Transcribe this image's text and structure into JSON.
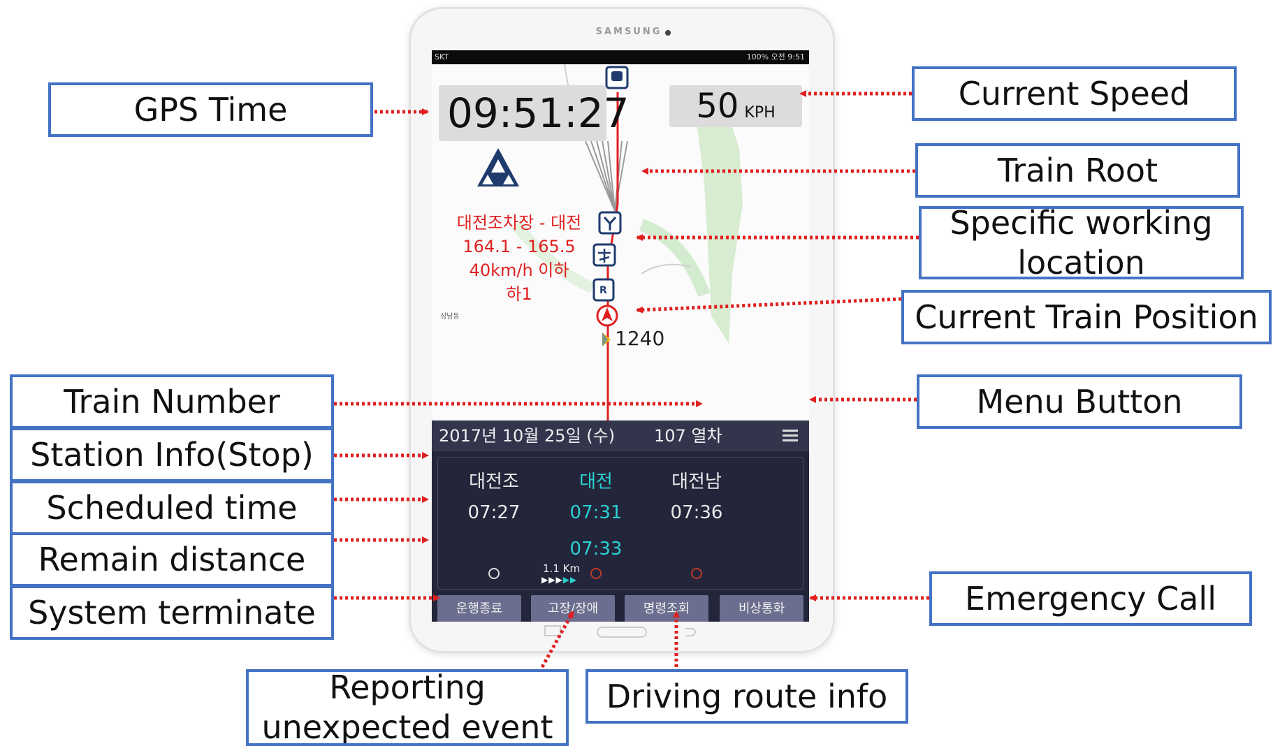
{
  "device": {
    "brand": "SAMSUNG",
    "status_left": "SKT",
    "status_right": "100% 오전 9:51"
  },
  "app": {
    "gps_time": "09:51:27",
    "speed_value": "50",
    "speed_unit": "KPH",
    "warning": {
      "line1": "대전조차장 - 대전",
      "line2": "164.1 - 165.5",
      "line3": "40km/h 이하",
      "line4": "하1"
    },
    "map_place_small": "성남동",
    "km_marker": "1240",
    "date": "2017년 10월 25일 (수)",
    "train_number": "107 열차",
    "stations": [
      {
        "name": "대전조",
        "time": "07:27",
        "time2": ""
      },
      {
        "name": "대전",
        "time": "07:31",
        "time2": "07:33"
      },
      {
        "name": "대전남",
        "time": "07:36",
        "time2": ""
      }
    ],
    "remain_distance": "1.1 Km",
    "buttons": [
      "운행종료",
      "고장/장애",
      "명령조회",
      "비상통화"
    ]
  },
  "labels": {
    "gps_time": "GPS Time",
    "current_speed": "Current Speed",
    "train_root": "Train Root",
    "specific_working_line1": "Specific working",
    "specific_working_line2": "location",
    "current_position": "Current Train Position",
    "train_number": "Train Number",
    "station_info": "Station Info(Stop)",
    "scheduled_time": "Scheduled time",
    "remain_distance": "Remain distance",
    "system_terminate": "System terminate",
    "menu_button": "Menu Button",
    "emergency_call": "Emergency Call",
    "reporting_line1": "Reporting",
    "reporting_line2": "unexpected event",
    "driving_route": "Driving route info"
  },
  "colors": {
    "label_border": "#4472c4",
    "arrow": "#e02020",
    "panel_bg": "#23253a",
    "highlight": "#2bd0d0"
  }
}
